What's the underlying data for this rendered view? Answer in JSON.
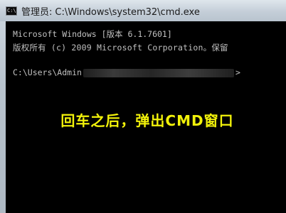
{
  "window": {
    "title_prefix": "管理员:",
    "title_path": "C:\\Windows\\system32\\cmd.exe",
    "app_icon_glyph": "C:\\"
  },
  "console": {
    "line1": "Microsoft Windows [版本 6.1.7601]",
    "line2": "版权所有 (c) 2009 Microsoft Corporation。保留",
    "prompt_start": "C:\\Users\\Admin",
    "prompt_end": ">"
  },
  "caption": "回车之后，弹出CMD窗口",
  "colors": {
    "console_bg": "#000000",
    "console_text": "#c0c0c0",
    "caption_text": "#f2f20a"
  }
}
